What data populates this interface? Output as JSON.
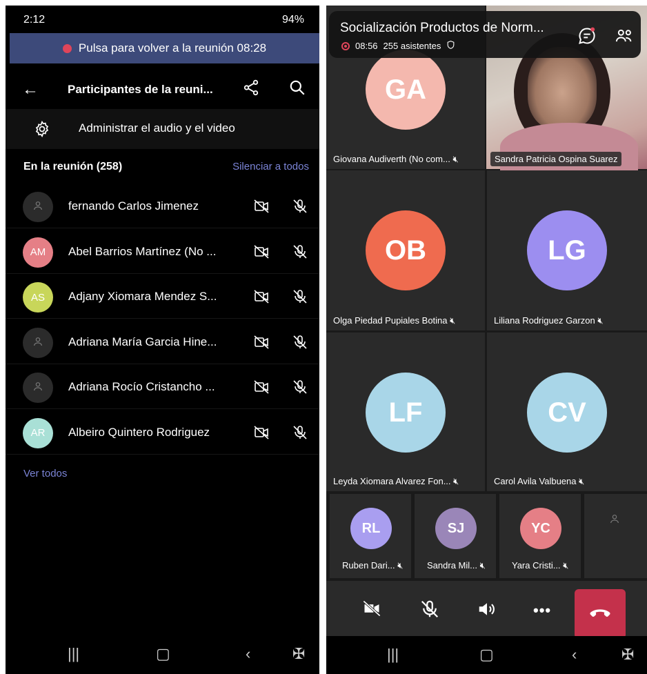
{
  "left": {
    "status": {
      "time": "2:12",
      "battery": "94%"
    },
    "banner": {
      "text": "Pulsa para volver a la reunión 08:28"
    },
    "header": {
      "title": "Participantes de la reuni..."
    },
    "manage": {
      "label": "Administrar el audio y el video"
    },
    "section": {
      "heading": "En la reunión (258)",
      "mute_all": "Silenciar a todos"
    },
    "participants": [
      {
        "initials": "",
        "name": "fernando Carlos Jimenez",
        "color": "#2b2b2b"
      },
      {
        "initials": "AM",
        "name": "Abel Barrios Martínez (No ...",
        "color": "#e57f86"
      },
      {
        "initials": "AS",
        "name": "Adjany Xiomara Mendez S...",
        "color": "#c8d65a"
      },
      {
        "initials": "",
        "name": "Adriana María Garcia Hine...",
        "color": "#2b2b2b"
      },
      {
        "initials": "",
        "name": "Adriana Rocío Cristancho ...",
        "color": "#2b2b2b"
      },
      {
        "initials": "AR",
        "name": "Albeiro Quintero Rodriguez",
        "color": "#a9e0d6"
      }
    ],
    "see_all": "Ver todos"
  },
  "right": {
    "meeting": {
      "title": "Socialización Productos de Norm...",
      "elapsed": "08:56",
      "attendees": "255 asistentes"
    },
    "tiles": [
      {
        "initials": "GA",
        "label": "Giovana Audiverth (No com...",
        "color": "#f4b8ae"
      },
      {
        "initials": "",
        "label": "Sandra Patricia Ospina Suarez",
        "color": ""
      },
      {
        "initials": "OB",
        "label": "Olga Piedad Pupiales Botina",
        "color": "#ef6b4f"
      },
      {
        "initials": "LG",
        "label": "Liliana Rodriguez Garzon",
        "color": "#9c8ef0"
      },
      {
        "initials": "LF",
        "label": "Leyda Xiomara Alvarez Fon...",
        "color": "#a9d6e8"
      },
      {
        "initials": "CV",
        "label": "Carol Avila Valbuena",
        "color": "#a9d6e8"
      }
    ],
    "small_tiles": [
      {
        "initials": "RL",
        "label": "Ruben Dari...",
        "color": "#a99ef0"
      },
      {
        "initials": "SJ",
        "label": "Sandra Mil...",
        "color": "#9a86b8"
      },
      {
        "initials": "YC",
        "label": "Yara Cristi...",
        "color": "#e57f86"
      },
      {
        "initials": "",
        "label": "",
        "color": "#2a2a2a"
      }
    ]
  },
  "icons": {
    "cam_off": "camera-off-icon",
    "mic_off": "mic-off-icon",
    "speaker": "speaker-icon",
    "more": "more-icon",
    "hangup": "hangup-icon"
  },
  "colors": {
    "accent": "#7b84d6",
    "banner": "#3d4a7a",
    "hangup": "#c4314b",
    "recording": "#e0455a"
  }
}
